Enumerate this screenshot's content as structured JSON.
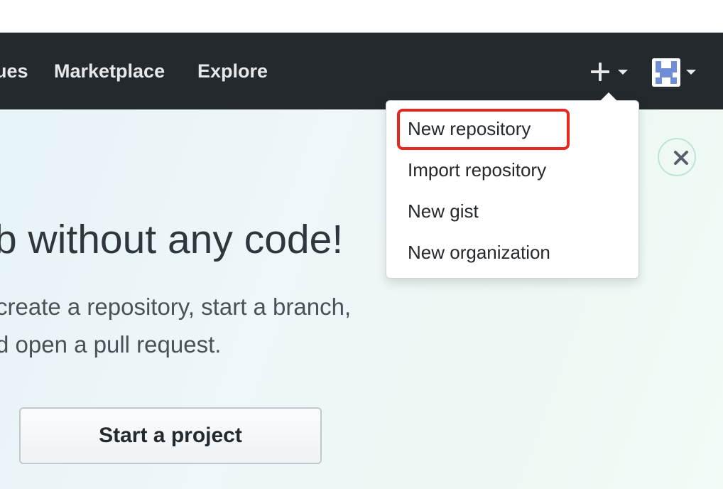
{
  "header": {
    "nav": [
      {
        "label": "ues"
      },
      {
        "label": "Marketplace"
      },
      {
        "label": "Explore"
      }
    ],
    "create_menu_icon": "plus-icon",
    "avatar_icon": "identicon-avatar"
  },
  "dropdown": {
    "items": [
      {
        "label": "New repository"
      },
      {
        "label": "Import repository"
      },
      {
        "label": "New gist"
      },
      {
        "label": "New organization"
      }
    ],
    "highlighted_item": "New repository",
    "highlight_color": "#e8281e"
  },
  "hero": {
    "heading": "b without any code!",
    "text_line_1": "create a repository, start a branch,",
    "text_line_2": "d open a pull request.",
    "cta_label": "Start a project",
    "close_icon": "close-icon"
  },
  "colors": {
    "header_bg": "#24292e",
    "header_text": "#e6e8ea",
    "avatar_color": "#6f8ed7"
  }
}
